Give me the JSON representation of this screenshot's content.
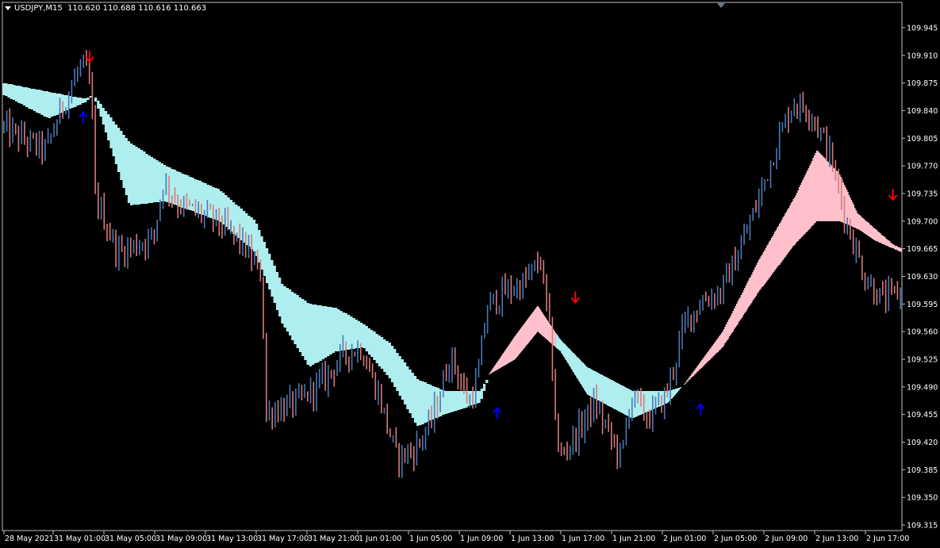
{
  "header": {
    "symbol_timeframe": "USDJPY,M15",
    "quote": "110.620 110.688 110.616 110.663",
    "menu_icon": "triangle-down-icon"
  },
  "colors": {
    "background": "#000000",
    "axis": "#c0c0c0",
    "bull_candle": "#4a79b7",
    "bear_candle": "#d77a7a",
    "band_up": "#afeeee",
    "band_down": "#ffc0cb",
    "arrow_buy": "#0000ff",
    "arrow_sell": "#ff0000"
  },
  "chart_data": {
    "type": "candlestick",
    "title": "",
    "y_axis": {
      "ticks": [
        "109.945",
        "109.910",
        "109.875",
        "109.840",
        "109.805",
        "109.770",
        "109.735",
        "109.700",
        "109.665",
        "109.630",
        "109.595",
        "109.560",
        "109.525",
        "109.490",
        "109.455",
        "109.420",
        "109.385",
        "109.350",
        "109.315"
      ],
      "ylim": [
        109.308,
        109.963
      ]
    },
    "x_axis": {
      "ticks": [
        "28 May 2021",
        "31 May 01:00",
        "31 May 05:00",
        "31 May 09:00",
        "31 May 13:00",
        "31 May 17:00",
        "31 May 21:00",
        "1 Jun 01:00",
        "1 Jun 05:00",
        "1 Jun 09:00",
        "1 Jun 13:00",
        "1 Jun 17:00",
        "1 Jun 21:00",
        "2 Jun 01:00",
        "2 Jun 05:00",
        "2 Jun 09:00",
        "2 Jun 13:00",
        "2 Jun 17:00"
      ]
    },
    "price_path_anchors": [
      [
        0,
        109.82
      ],
      [
        0.03,
        109.8
      ],
      [
        0.05,
        109.79
      ],
      [
        0.07,
        109.85
      ],
      [
        0.09,
        109.9
      ],
      [
        0.1,
        109.87
      ],
      [
        0.105,
        109.73
      ],
      [
        0.13,
        109.66
      ],
      [
        0.15,
        109.67
      ],
      [
        0.17,
        109.68
      ],
      [
        0.18,
        109.75
      ],
      [
        0.2,
        109.72
      ],
      [
        0.24,
        109.7
      ],
      [
        0.27,
        109.67
      ],
      [
        0.29,
        109.63
      ],
      [
        0.295,
        109.45
      ],
      [
        0.3,
        109.46
      ],
      [
        0.33,
        109.47
      ],
      [
        0.36,
        109.5
      ],
      [
        0.38,
        109.53
      ],
      [
        0.4,
        109.54
      ],
      [
        0.42,
        109.48
      ],
      [
        0.44,
        109.4
      ],
      [
        0.46,
        109.41
      ],
      [
        0.48,
        109.45
      ],
      [
        0.5,
        109.53
      ],
      [
        0.52,
        109.47
      ],
      [
        0.53,
        109.5
      ],
      [
        0.54,
        109.59
      ],
      [
        0.56,
        109.61
      ],
      [
        0.58,
        109.62
      ],
      [
        0.6,
        109.65
      ],
      [
        0.61,
        109.56
      ],
      [
        0.62,
        109.4
      ],
      [
        0.64,
        109.43
      ],
      [
        0.66,
        109.47
      ],
      [
        0.68,
        109.42
      ],
      [
        0.69,
        109.4
      ],
      [
        0.7,
        109.48
      ],
      [
        0.72,
        109.45
      ],
      [
        0.74,
        109.48
      ],
      [
        0.76,
        109.57
      ],
      [
        0.78,
        109.6
      ],
      [
        0.8,
        109.61
      ],
      [
        0.82,
        109.66
      ],
      [
        0.84,
        109.72
      ],
      [
        0.86,
        109.79
      ],
      [
        0.88,
        109.85
      ],
      [
        0.9,
        109.84
      ],
      [
        0.92,
        109.79
      ],
      [
        0.94,
        109.7
      ],
      [
        0.96,
        109.63
      ],
      [
        0.98,
        109.6
      ],
      [
        1.0,
        109.61
      ]
    ],
    "band_anchors": {
      "outer": [
        [
          0,
          109.875
        ],
        [
          0.09,
          109.855
        ],
        [
          0.1,
          109.86
        ],
        [
          0.14,
          109.8
        ],
        [
          0.18,
          109.77
        ],
        [
          0.24,
          109.74
        ],
        [
          0.28,
          109.7
        ],
        [
          0.31,
          109.62
        ],
        [
          0.34,
          109.595
        ],
        [
          0.37,
          109.59
        ],
        [
          0.4,
          109.57
        ],
        [
          0.43,
          109.545
        ],
        [
          0.46,
          109.5
        ],
        [
          0.49,
          109.485
        ],
        [
          0.53,
          109.485
        ],
        [
          0.54,
          109.505
        ],
        [
          0.57,
          109.555
        ],
        [
          0.595,
          109.593
        ],
        [
          0.62,
          109.55
        ],
        [
          0.65,
          109.515
        ],
        [
          0.7,
          109.485
        ],
        [
          0.74,
          109.485
        ],
        [
          0.755,
          109.49
        ],
        [
          0.8,
          109.56
        ],
        [
          0.84,
          109.65
        ],
        [
          0.88,
          109.73
        ],
        [
          0.905,
          109.79
        ],
        [
          0.93,
          109.76
        ],
        [
          0.95,
          109.71
        ],
        [
          0.97,
          109.69
        ],
        [
          0.99,
          109.67
        ],
        [
          1.0,
          109.665
        ]
      ],
      "inner": [
        [
          0,
          109.86
        ],
        [
          0.05,
          109.83
        ],
        [
          0.09,
          109.85
        ],
        [
          0.1,
          109.86
        ],
        [
          0.14,
          109.72
        ],
        [
          0.18,
          109.725
        ],
        [
          0.24,
          109.7
        ],
        [
          0.28,
          109.66
        ],
        [
          0.31,
          109.57
        ],
        [
          0.34,
          109.515
        ],
        [
          0.37,
          109.535
        ],
        [
          0.4,
          109.54
        ],
        [
          0.43,
          109.5
        ],
        [
          0.46,
          109.44
        ],
        [
          0.49,
          109.455
        ],
        [
          0.53,
          109.47
        ],
        [
          0.54,
          109.505
        ],
        [
          0.57,
          109.525
        ],
        [
          0.595,
          109.56
        ],
        [
          0.62,
          109.535
        ],
        [
          0.65,
          109.48
        ],
        [
          0.7,
          109.45
        ],
        [
          0.74,
          109.47
        ],
        [
          0.755,
          109.49
        ],
        [
          0.8,
          109.54
        ],
        [
          0.84,
          109.61
        ],
        [
          0.88,
          109.67
        ],
        [
          0.905,
          109.7
        ],
        [
          0.93,
          109.7
        ],
        [
          0.95,
          109.69
        ],
        [
          0.97,
          109.675
        ],
        [
          0.99,
          109.665
        ],
        [
          1.0,
          109.66
        ]
      ],
      "segments": [
        {
          "color": "up",
          "from": 0,
          "to": 0.54
        },
        {
          "color": "down",
          "from": 0.54,
          "to": 0.615
        },
        {
          "color": "up",
          "from": 0.615,
          "to": 0.755
        },
        {
          "color": "down",
          "from": 0.755,
          "to": 1.0
        }
      ]
    },
    "signals": [
      {
        "type": "sell",
        "x": 0.097,
        "price": 109.91
      },
      {
        "type": "buy",
        "x": 0.09,
        "price": 109.83
      },
      {
        "type": "buy",
        "x": 0.55,
        "price": 109.455
      },
      {
        "type": "sell",
        "x": 0.637,
        "price": 109.605
      },
      {
        "type": "buy",
        "x": 0.776,
        "price": 109.46
      },
      {
        "type": "sell",
        "x": 0.99,
        "price": 109.735
      }
    ]
  }
}
